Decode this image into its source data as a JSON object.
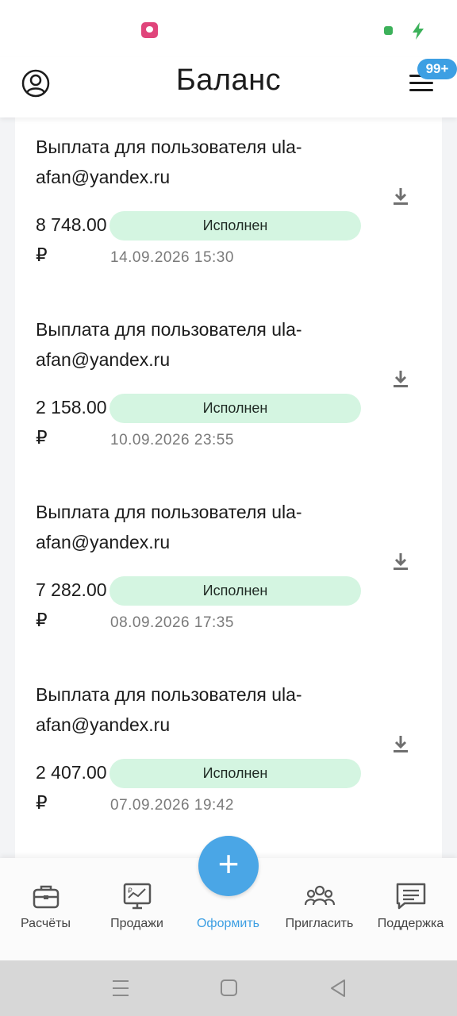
{
  "header": {
    "title": "Баланс",
    "badge": "99+",
    "profile_icon": "user-circle-icon",
    "menu_icon": "hamburger-menu-icon"
  },
  "status_bar": {
    "app_icon": "notification-app-icon",
    "icons": [
      "status-dot-icon",
      "charging-bolt-icon"
    ]
  },
  "payouts": [
    {
      "title": "Выплата для пользователя ula-afan@yandex.ru",
      "amount": "8 748.00 ₽",
      "status": "Исполнен",
      "date": "14.09.2026 15:30"
    },
    {
      "title": "Выплата для пользователя ula-afan@yandex.ru",
      "amount": "2 158.00 ₽",
      "status": "Исполнен",
      "date": "10.09.2026 23:55"
    },
    {
      "title": "Выплата для пользователя ula-afan@yandex.ru",
      "amount": "7 282.00 ₽",
      "status": "Исполнен",
      "date": "08.09.2026 17:35"
    },
    {
      "title": "Выплата для пользователя ula-afan@yandex.ru",
      "amount": "2 407.00 ₽",
      "status": "Исполнен",
      "date": "07.09.2026 19:42"
    }
  ],
  "bottom_nav": {
    "items": [
      {
        "label": "Расчёты",
        "icon": "briefcase-icon"
      },
      {
        "label": "Продажи",
        "icon": "sales-monitor-icon"
      },
      {
        "label": "Оформить",
        "icon": "plus-icon"
      },
      {
        "label": "Пригласить",
        "icon": "people-group-icon"
      },
      {
        "label": "Поддержка",
        "icon": "chat-bubble-icon"
      }
    ],
    "fab_label": "+"
  },
  "system_nav": {
    "icons": [
      "recent-apps-icon",
      "home-icon",
      "back-icon"
    ]
  },
  "colors": {
    "accent": "#3d9fe3",
    "status_pill_bg": "#d4f5e1",
    "status_green": "#3cb15a",
    "badge_bg": "#3d9fe3"
  }
}
